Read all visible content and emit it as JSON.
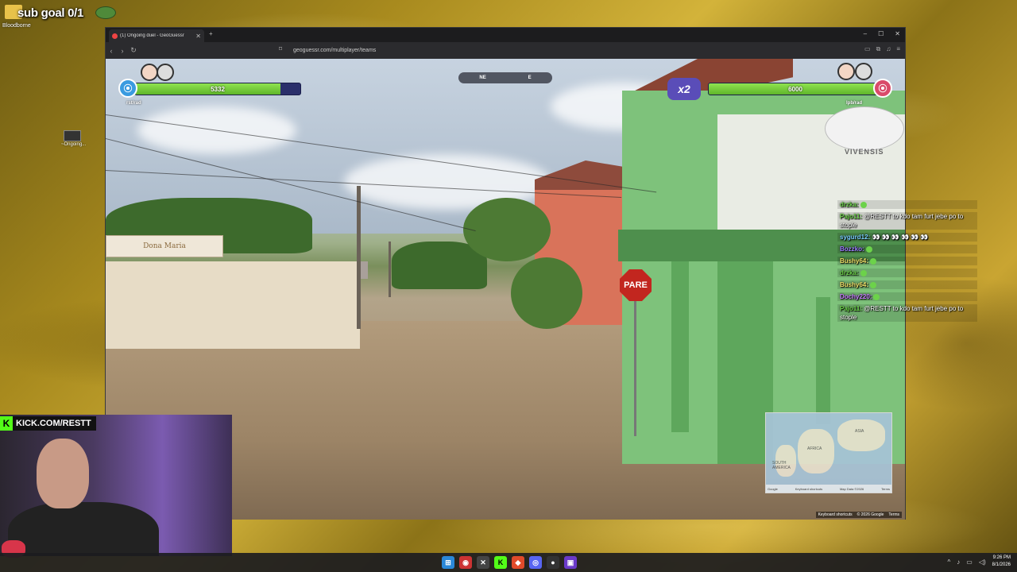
{
  "desktop": {
    "sub_goal": "sub goal 0/1",
    "folder_label": "Bloodborne",
    "file_label": "~Ongoing..."
  },
  "browser": {
    "tab_title": "(1) Ongoing duel - GeoGuessr",
    "tab_close": "✕",
    "tab_new": "+",
    "url": "geoguessr.com/multiplayer/teams",
    "back_glyph": "‹",
    "forward_glyph": "›",
    "reload_glyph": "↻",
    "bookmark_glyph": "⌑",
    "minimize_glyph": "–",
    "maximize_glyph": "☐",
    "close_glyph": "✕",
    "extensions_glyph": "⧉",
    "music_glyph": "♫",
    "menu_glyph": "≡",
    "cast_glyph": "▭"
  },
  "game": {
    "left_team": {
      "score": "5332",
      "health_fraction": 0.88,
      "players": "rst/rad",
      "color": "#3a9be0"
    },
    "right_team": {
      "score": "6000",
      "health_fraction": 1.0,
      "players": "lpb/rad",
      "color": "#d94a6a"
    },
    "multiplier": "x2",
    "compass": {
      "ne": "NE",
      "e": "E"
    },
    "stop_sign": "PARE",
    "dish_brand": "VIVENSIS",
    "shop_sign": "Dona Maria",
    "minimap": {
      "africa": "AFRICA",
      "south_america": "SOUTH AMERICA",
      "asia": "ASIA",
      "google": "Google",
      "shortcuts": "Keyboard shortcuts",
      "map_data": "Map Data ©2026",
      "terms": "Terms"
    },
    "street_footer": {
      "shortcuts": "Keyboard shortcuts",
      "copyright": "© 2026 Google",
      "terms": "Terms"
    }
  },
  "chat": [
    {
      "user": "drzka:",
      "text": "",
      "color": "#6cd24a",
      "emote": true
    },
    {
      "user": "Pajo11:",
      "text": "@RESTT to kdo tam furt jebe po to stople",
      "color": "#6cd24a",
      "emote": false
    },
    {
      "user": "sygurd12:",
      "text": "👀 👀 👀 👀 👀 👀",
      "color": "#7bd0ff",
      "emote": false
    },
    {
      "user": "Bozzko:",
      "text": "",
      "color": "#9b7bff",
      "emote": true
    },
    {
      "user": "Bushy64:",
      "text": "",
      "color": "#f0e36a",
      "emote": true
    },
    {
      "user": "drzka:",
      "text": "",
      "color": "#6cd24a",
      "emote": true
    },
    {
      "user": "Bushy64:",
      "text": "",
      "color": "#f0e36a",
      "emote": true
    },
    {
      "user": "Dochy220:",
      "text": "",
      "color": "#c87bff",
      "emote": true
    },
    {
      "user": "Pajo11:",
      "text": "@RESTT to kdo tam furt jebe po to stople",
      "color": "#6cd24a",
      "emote": false
    }
  ],
  "webcam": {
    "kick_letter": "K",
    "kick_url": "KICK.COM/RESTT"
  },
  "taskbar": {
    "time": "9:26 PM",
    "date": "8/1/2026",
    "tray_chevron": "^"
  }
}
